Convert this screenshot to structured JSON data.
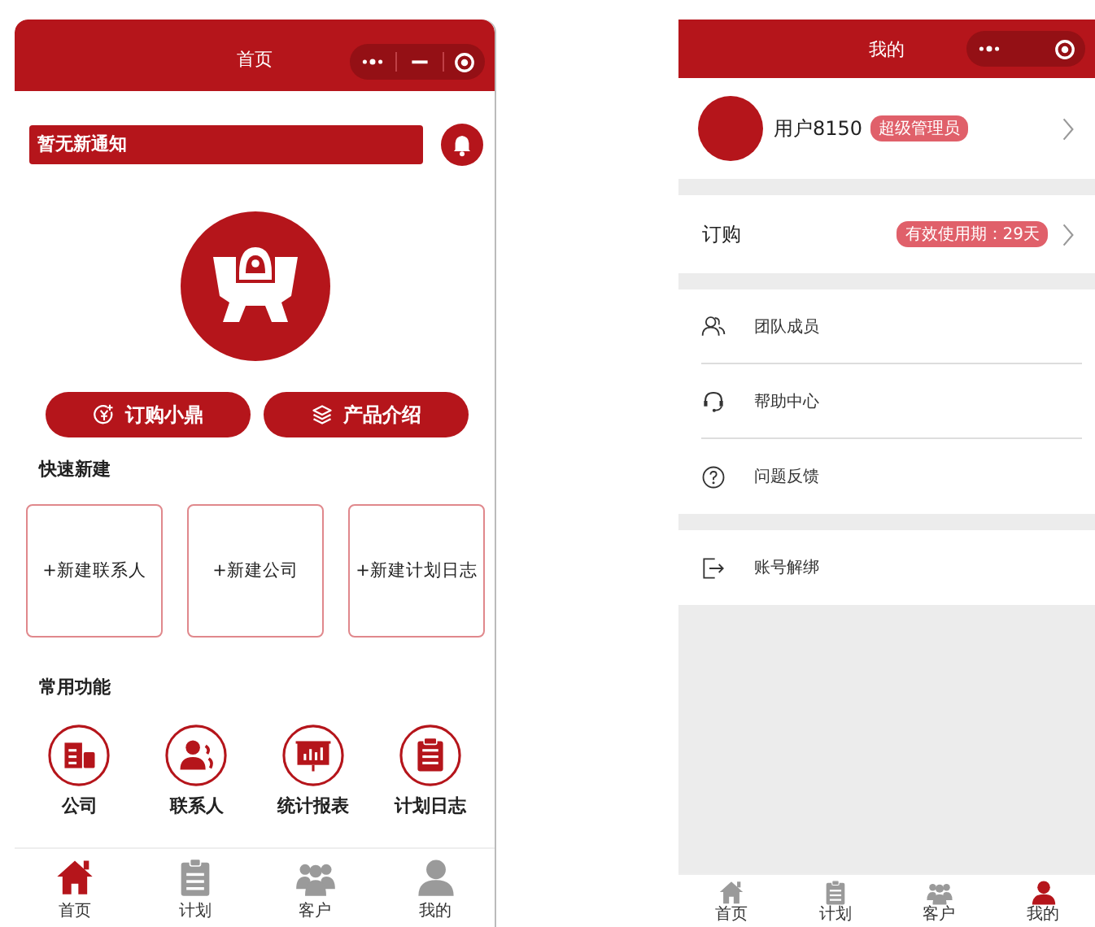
{
  "home_screen": {
    "title": "首页",
    "notice": "暂无新通知",
    "buttons": [
      "订购小鼎",
      "产品介绍"
    ],
    "quick_create": {
      "title": "快速新建",
      "items": [
        "+新建联系人",
        "+新建公司",
        "+新建计划日志"
      ]
    },
    "common_functions": {
      "title": "常用功能",
      "items": [
        "公司",
        "联系人",
        "统计报表",
        "计划日志"
      ]
    },
    "tabs": [
      {
        "label": "首页",
        "selected": true
      },
      {
        "label": "计划",
        "selected": false
      },
      {
        "label": "客户",
        "selected": false
      },
      {
        "label": "我的",
        "selected": false
      }
    ]
  },
  "profile_screen": {
    "title": "我的",
    "user": {
      "name": "用户8150",
      "role": "超级管理员"
    },
    "order": {
      "label": "订购",
      "validity": "有效使用期：29天"
    },
    "menu": [
      "团队成员",
      "帮助中心",
      "问题反馈"
    ],
    "unbind": "账号解绑",
    "tabs": [
      {
        "label": "首页",
        "selected": false
      },
      {
        "label": "计划",
        "selected": false
      },
      {
        "label": "客户",
        "selected": false
      },
      {
        "label": "我的",
        "selected": true
      }
    ]
  }
}
